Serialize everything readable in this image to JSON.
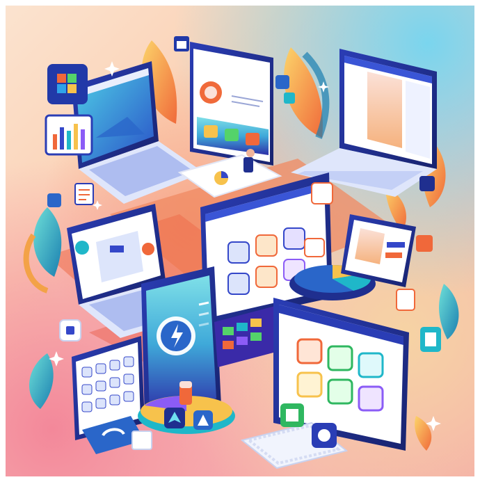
{
  "scene": {
    "accent_colors": {
      "navy": "#1f2f8f",
      "royal": "#3447c9",
      "orange": "#f0683a",
      "teal": "#1fb7c9",
      "yellow": "#f7c24c",
      "purple": "#8b5cf6"
    },
    "icons": [
      "windows-logo-icon",
      "bar-chart-icon",
      "calendar-icon",
      "leaf-icon",
      "compass-icon",
      "cloud-icon",
      "pie-chart-icon",
      "document-icon",
      "keyboard-icon",
      "person-at-desk-icon"
    ]
  }
}
